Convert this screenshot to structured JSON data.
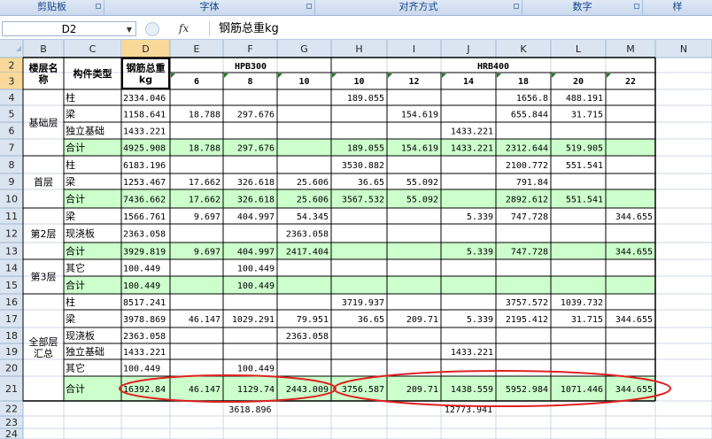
{
  "ribbon": {
    "groups": [
      "剪贴板",
      "字体",
      "对齐方式",
      "数字",
      "样"
    ]
  },
  "formula_bar": {
    "name_box": "D2",
    "fx_label": "fx",
    "content": "钢筋总重kg"
  },
  "columns": [
    "B",
    "C",
    "D",
    "E",
    "F",
    "G",
    "H",
    "I",
    "J",
    "K",
    "L",
    "M",
    "N"
  ],
  "rows": [
    "2",
    "3",
    "4",
    "5",
    "6",
    "7",
    "8",
    "9",
    "10",
    "11",
    "12",
    "13",
    "14",
    "15",
    "16",
    "17",
    "18",
    "19",
    "20",
    "21",
    "22",
    "23",
    "24"
  ],
  "headers": {
    "floor_name": "楼层名称",
    "component_type": "构件类型",
    "total_weight": "钢筋总重kg",
    "hpb300": "HPB300",
    "hrb400": "HRB400",
    "hpb_diameters": [
      "6",
      "8",
      "10"
    ],
    "hrb_diameters": [
      "10",
      "12",
      "14",
      "18",
      "20",
      "22"
    ]
  },
  "floors": {
    "basement": "基础层",
    "first": "首层",
    "second": "第2层",
    "third": "第3层",
    "all": "全部层汇总"
  },
  "table_rows": [
    {
      "type": "柱",
      "total": "2334.046",
      "e": "",
      "f": "",
      "g": "",
      "h": "189.055",
      "i": "",
      "j": "",
      "k": "1656.8",
      "l": "488.191",
      "m": ""
    },
    {
      "type": "梁",
      "total": "1158.641",
      "e": "18.788",
      "f": "297.676",
      "g": "",
      "h": "",
      "i": "154.619",
      "j": "",
      "k": "655.844",
      "l": "31.715",
      "m": ""
    },
    {
      "type": "独立基础",
      "total": "1433.221",
      "e": "",
      "f": "",
      "g": "",
      "h": "",
      "i": "",
      "j": "1433.221",
      "k": "",
      "l": "",
      "m": ""
    },
    {
      "type": "合计",
      "total": "4925.908",
      "e": "18.788",
      "f": "297.676",
      "g": "",
      "h": "189.055",
      "i": "154.619",
      "j": "1433.221",
      "k": "2312.644",
      "l": "519.905",
      "m": ""
    },
    {
      "type": "柱",
      "total": "6183.196",
      "e": "",
      "f": "",
      "g": "",
      "h": "3530.882",
      "i": "",
      "j": "",
      "k": "2100.772",
      "l": "551.541",
      "m": ""
    },
    {
      "type": "梁",
      "total": "1253.467",
      "e": "17.662",
      "f": "326.618",
      "g": "25.606",
      "h": "36.65",
      "i": "55.092",
      "j": "",
      "k": "791.84",
      "l": "",
      "m": ""
    },
    {
      "type": "合计",
      "total": "7436.662",
      "e": "17.662",
      "f": "326.618",
      "g": "25.606",
      "h": "3567.532",
      "i": "55.092",
      "j": "",
      "k": "2892.612",
      "l": "551.541",
      "m": ""
    },
    {
      "type": "梁",
      "total": "1566.761",
      "e": "9.697",
      "f": "404.997",
      "g": "54.345",
      "h": "",
      "i": "",
      "j": "5.339",
      "k": "747.728",
      "l": "",
      "m": "344.655"
    },
    {
      "type": "现浇板",
      "total": "2363.058",
      "e": "",
      "f": "",
      "g": "2363.058",
      "h": "",
      "i": "",
      "j": "",
      "k": "",
      "l": "",
      "m": ""
    },
    {
      "type": "合计",
      "total": "3929.819",
      "e": "9.697",
      "f": "404.997",
      "g": "2417.404",
      "h": "",
      "i": "",
      "j": "5.339",
      "k": "747.728",
      "l": "",
      "m": "344.655"
    },
    {
      "type": "其它",
      "total": "100.449",
      "e": "",
      "f": "100.449",
      "g": "",
      "h": "",
      "i": "",
      "j": "",
      "k": "",
      "l": "",
      "m": ""
    },
    {
      "type": "合计",
      "total": "100.449",
      "e": "",
      "f": "100.449",
      "g": "",
      "h": "",
      "i": "",
      "j": "",
      "k": "",
      "l": "",
      "m": ""
    },
    {
      "type": "柱",
      "total": "8517.241",
      "e": "",
      "f": "",
      "g": "",
      "h": "3719.937",
      "i": "",
      "j": "",
      "k": "3757.572",
      "l": "1039.732",
      "m": ""
    },
    {
      "type": "梁",
      "total": "3978.869",
      "e": "46.147",
      "f": "1029.291",
      "g": "79.951",
      "h": "36.65",
      "i": "209.71",
      "j": "5.339",
      "k": "2195.412",
      "l": "31.715",
      "m": "344.655"
    },
    {
      "type": "现浇板",
      "total": "2363.058",
      "e": "",
      "f": "",
      "g": "2363.058",
      "h": "",
      "i": "",
      "j": "",
      "k": "",
      "l": "",
      "m": ""
    },
    {
      "type": "独立基础",
      "total": "1433.221",
      "e": "",
      "f": "",
      "g": "",
      "h": "",
      "i": "",
      "j": "1433.221",
      "k": "",
      "l": "",
      "m": ""
    },
    {
      "type": "其它",
      "total": "100.449",
      "e": "",
      "f": "100.449",
      "g": "",
      "h": "",
      "i": "",
      "j": "",
      "k": "",
      "l": "",
      "m": ""
    },
    {
      "type": "合计",
      "total": "16392.84",
      "e": "46.147",
      "f": "1129.74",
      "g": "2443.009",
      "h": "3756.587",
      "i": "209.71",
      "j": "1438.559",
      "k": "5952.984",
      "l": "1071.446",
      "m": "344.655"
    }
  ],
  "row22": {
    "hpb300_sum": "3618.896",
    "hrb400_sum": "12773.941"
  },
  "colors": {
    "subtotal_fill": "#ccffcc",
    "header_fill": "#dbe5f1",
    "selected_header": "#f9d99a",
    "ellipse": "#e02020"
  }
}
